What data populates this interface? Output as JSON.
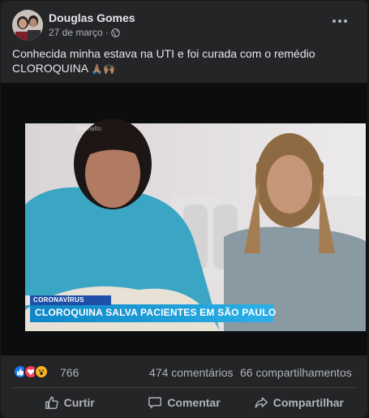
{
  "post": {
    "author": "Douglas Gomes",
    "date": "27 de março",
    "date_separator": "·",
    "more_icon": "more-options-icon",
    "privacy_icon": "globe-icon",
    "text_line1": "Conhecida minha estava na UTI e foi curada com o remédio",
    "text_line2": "CLOROQUINA",
    "text_emojis": "🙏🏽🙌🏽"
  },
  "media": {
    "chyron_category": "CORONAVÍRUS",
    "chyron_headline": "CLOROQUINA SALVA PACIENTES EM SÃO PAULO",
    "watermark": "Planalto"
  },
  "engagement": {
    "reaction_icons": [
      "like-icon",
      "love-icon",
      "wow-icon"
    ],
    "reaction_count": "766",
    "comments": "474 comentários",
    "shares": "66 compartilhamentos"
  },
  "actions": {
    "like": "Curtir",
    "comment": "Comentar",
    "share": "Compartilhar"
  },
  "colors": {
    "background": "#242526",
    "text": "#e4e6eb",
    "secondary_text": "#b0b3b8",
    "like_blue": "#1877f2",
    "love_red": "#f33e58",
    "wow_yellow": "#f7b125",
    "chyron_blue": "#1e9ed8"
  }
}
